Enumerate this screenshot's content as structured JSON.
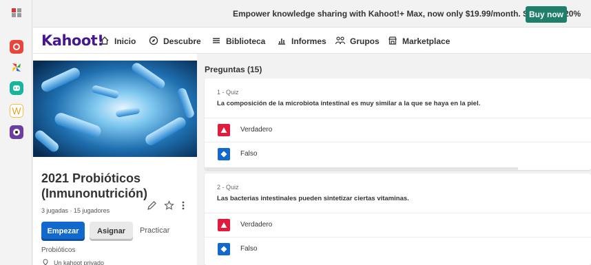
{
  "banner": {
    "message": "Empower knowledge sharing with Kahoot!+ Max, now only $19.99/month. Save over 20%",
    "buy_label": "Buy now"
  },
  "nav": {
    "logo": "Kahoot!",
    "items": [
      {
        "label": "Inicio",
        "icon": "home-icon"
      },
      {
        "label": "Descubre",
        "icon": "compass-icon"
      },
      {
        "label": "Biblioteca",
        "icon": "list-icon"
      },
      {
        "label": "Informes",
        "icon": "chart-icon"
      },
      {
        "label": "Grupos",
        "icon": "people-icon"
      },
      {
        "label": "Marketplace",
        "icon": "store-icon"
      }
    ]
  },
  "kahoot": {
    "title": "2021 Probióticos (Inmunonutrición)",
    "meta": "3 jugadas · 15 jugadores",
    "start_label": "Empezar",
    "assign_label": "Asignar",
    "practice_label": "Practicar",
    "category": "Probióticos",
    "visibility": "Un kahoot privado"
  },
  "questions": {
    "heading": "Preguntas (15)",
    "items": [
      {
        "type": "1 - Quiz",
        "text": "La composición de la microbiota intestinal es muy similar a la que se haya en la piel.",
        "answers": [
          {
            "label": "Verdadero",
            "shape": "triangle",
            "color": "#e21b3c"
          },
          {
            "label": "Falso",
            "shape": "diamond",
            "color": "#1368ce"
          }
        ]
      },
      {
        "type": "2 - Quiz",
        "text": "Las bacterias intestinales pueden sintetizar ciertas vitaminas.",
        "answers": [
          {
            "label": "Verdadero",
            "shape": "triangle",
            "color": "#e21b3c"
          },
          {
            "label": "Falso",
            "shape": "diamond",
            "color": "#1368ce"
          }
        ]
      }
    ]
  },
  "colors": {
    "brand": "#46178f",
    "primary": "#1368ce",
    "buy": "#1f7f6b"
  }
}
